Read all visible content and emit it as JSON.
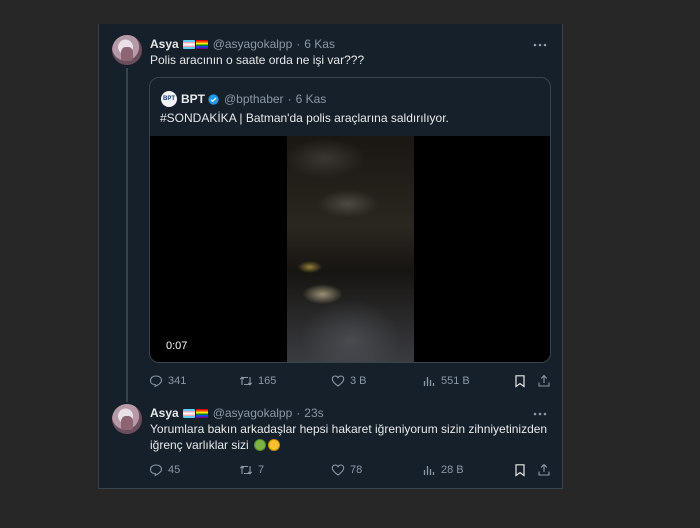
{
  "tweet1": {
    "name": "Asya",
    "handle": "@asyagokalpp",
    "time": "6 Kas",
    "text": "Polis aracının o saate orda ne işi var???",
    "quote": {
      "avatar_text": "BPT",
      "name": "BPT",
      "handle": "@bpthaber",
      "time": "6 Kas",
      "text": "#SONDAKİKA | Batman'da polis araçlarına saldırılıyor.",
      "video_duration": "0:07"
    },
    "stats": {
      "replies": "341",
      "retweets": "165",
      "likes": "3 B",
      "views": "551 B"
    }
  },
  "tweet2": {
    "name": "Asya",
    "handle": "@asyagokalpp",
    "time": "23s",
    "text_line1": "Yorumlara bakın arkadaşlar hepsi hakaret iğreniyorum sizin zihniyetinizden",
    "text_line2": "iğrenç varlıklar sizi",
    "stats": {
      "replies": "45",
      "retweets": "7",
      "likes": "78",
      "views": "28 B"
    }
  },
  "icons": {
    "more": "more-horizontal-icon",
    "reply": "reply-icon",
    "retweet": "retweet-icon",
    "like": "heart-icon",
    "views": "views-icon",
    "bookmark": "bookmark-icon",
    "share": "share-icon",
    "verified": "verified-badge-icon",
    "flags": [
      "transgender-flag-icon",
      "rainbow-flag-icon"
    ],
    "emojis": [
      "nauseated-face-icon",
      "vomiting-face-icon"
    ]
  },
  "colors": {
    "background": "#15202b",
    "border": "#38444d",
    "secondary_text": "#8b98a5",
    "primary_text": "#e7e9ea",
    "verified": "#1d9bf0"
  }
}
